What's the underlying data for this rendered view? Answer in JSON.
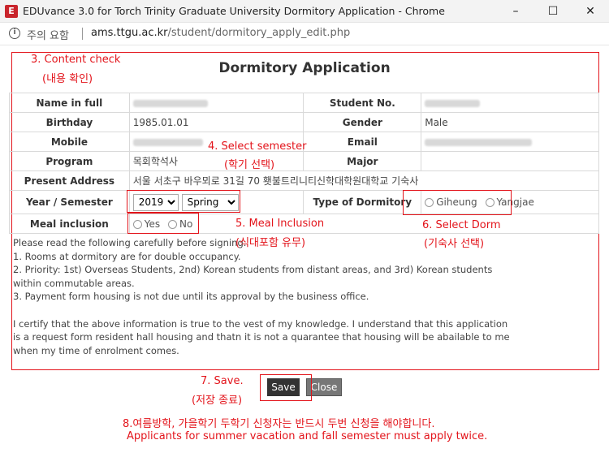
{
  "window": {
    "title": "EDUvance 3.0 for Torch Trinity Graduate University Dormitory Application - Chrome",
    "app_icon": "E",
    "minimize": "–",
    "maximize": "☐",
    "close": "✕"
  },
  "address": {
    "security_text": "주의 요함",
    "host": "ams.ttgu.ac.kr",
    "path": "/student/dormitory_apply_edit.php"
  },
  "form": {
    "title": "Dormitory Application",
    "labels": {
      "name": "Name in full",
      "student_no": "Student No.",
      "birthday": "Birthday",
      "gender": "Gender",
      "mobile": "Mobile",
      "email": "Email",
      "program": "Program",
      "major": "Major",
      "address": "Present Address",
      "year_semester": "Year / Semester",
      "dormitory_type": "Type of Dormitory",
      "meal": "Meal inclusion"
    },
    "values": {
      "birthday": "1985.01.01",
      "gender": "Male",
      "program": "목회학석사",
      "address": "서울 서초구 바우뫼로 31길 70 횃불트리니티신학대학원대학교 기숙사"
    },
    "year_selected": "2019",
    "semester_selected": "Spring",
    "dorm_options": [
      "Giheung",
      "Yangjae"
    ],
    "meal_options": [
      "Yes",
      "No"
    ]
  },
  "notice": [
    "Please read the following carefully before signing.",
    "1. Rooms at dormitory are for double occupancy.",
    "2. Priority: 1st) Overseas Students, 2nd) Korean students from distant areas, and 3rd) Korean students",
    "within commutable areas.",
    "3. Payment form housing is not due until its approval by the business office.",
    "",
    "I certify that the above information is true to the vest of my knowledge. I understand that this application",
    "is a request form resident hall housing and thatn it is not a quarantee that housing will be abailable to me",
    "when my time of enrolment comes."
  ],
  "buttons": {
    "save": "Save",
    "close": "Close"
  },
  "annotations": {
    "content_check_en": "3. Content check",
    "content_check_ko": "(내용 확인)",
    "select_semester_en": "4. Select semester",
    "select_semester_ko": "(학기 선택)",
    "meal_en": "5. Meal Inclusion",
    "meal_ko": "(식대포함 유무)",
    "dorm_en": "6. Select Dorm",
    "dorm_ko": "(기숙사 선택)",
    "save_en": "7. Save.",
    "save_ko": "(저장 종료)",
    "note_ko": "8.여름방학, 가을학기 두학기 신청자는 반드시 두번 신청을 해야합니다.",
    "note_en": "Applicants for summer vacation and fall semester must apply twice."
  },
  "colors": {
    "annotation": "#e3141b",
    "save_button": "#333333",
    "close_button": "#777777"
  }
}
